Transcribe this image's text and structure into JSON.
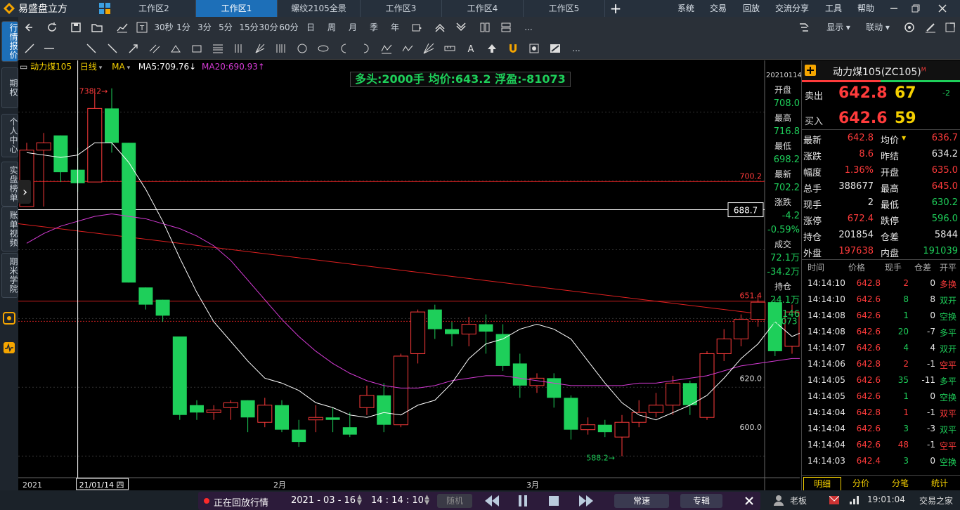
{
  "app": {
    "name": "易盛盘立方"
  },
  "tabs": [
    {
      "label": "工作区2",
      "active": false
    },
    {
      "label": "工作区1",
      "active": true
    },
    {
      "label": "螺纹2105全景",
      "active": false
    },
    {
      "label": "工作区3",
      "active": false
    },
    {
      "label": "工作区4",
      "active": false
    },
    {
      "label": "工作区5",
      "active": false
    }
  ],
  "add_tab": "+",
  "menu": [
    "系统",
    "交易",
    "回放",
    "交流分享",
    "工具",
    "帮助"
  ],
  "toolbar": {
    "periods": [
      "30秒",
      "1分",
      "3分",
      "5分",
      "15分",
      "30分",
      "60分",
      "日",
      "周",
      "月",
      "季",
      "年"
    ],
    "more": "...",
    "display_label": "显示",
    "link_label": "联动"
  },
  "draw_more": "...",
  "sidebar": [
    "行情报价",
    "期权",
    "个人中心",
    "实盘榜单",
    "账单视频",
    "期米学院"
  ],
  "chart_header": {
    "symbol": "动力煤105",
    "period": "日线",
    "indicator": "MA",
    "ma5": "MA5:709.76↓",
    "ma20": "MA20:690.93↑"
  },
  "position_banner": "多头:2000手 均价:643.2 浮盈:-81073",
  "price_labels": {
    "high_mark": "738.2",
    "low_mark": "588.2",
    "line_700": "700.2",
    "line_651": "651.4",
    "crosshair": "688.7",
    "pnl": "-81073",
    "axis_620": "620.0",
    "axis_600": "600.0"
  },
  "x_axis": {
    "left_year": "2021",
    "cursor_date": "21/01/14 四",
    "feb": "2月",
    "mar": "3月"
  },
  "info_column": {
    "date": "20210114",
    "rows": [
      {
        "label": "开盘",
        "value": "708.0"
      },
      {
        "label": "最高",
        "value": "716.8"
      },
      {
        "label": "最低",
        "value": "698.2"
      },
      {
        "label": "最新",
        "value": "702.2"
      },
      {
        "label": "涨跌",
        "value": "-4.2"
      },
      {
        "label": "",
        "value": "-0.59%"
      },
      {
        "label": "成交",
        "value": "72.1万"
      },
      {
        "label": "",
        "value": "-34.2万"
      },
      {
        "label": "持仓",
        "value": "24.1万"
      },
      {
        "label": "",
        "value": "-6146"
      }
    ]
  },
  "quote": {
    "title": "动力煤105(ZC105)",
    "title_sup": "M",
    "ask": {
      "label": "卖出",
      "price": "642.8",
      "vol": "67",
      "chg": "-2"
    },
    "bid": {
      "label": "买入",
      "price": "642.6",
      "vol": "59"
    },
    "stats": [
      {
        "l1": "最新",
        "v1": "642.8",
        "c1": "red",
        "l2": "均价",
        "v2": "636.7",
        "c2": "red"
      },
      {
        "l1": "涨跌",
        "v1": "8.6",
        "c1": "red",
        "l2": "昨结",
        "v2": "634.2",
        "c2": "white"
      },
      {
        "l1": "幅度",
        "v1": "1.36%",
        "c1": "red",
        "l2": "开盘",
        "v2": "635.0",
        "c2": "red"
      },
      {
        "l1": "总手",
        "v1": "388677",
        "c1": "white",
        "l2": "最高",
        "v2": "645.0",
        "c2": "red"
      },
      {
        "l1": "现手",
        "v1": "2",
        "c1": "white",
        "l2": "最低",
        "v2": "630.2",
        "c2": "green"
      },
      {
        "l1": "涨停",
        "v1": "672.4",
        "c1": "red",
        "l2": "跌停",
        "v2": "596.0",
        "c2": "green"
      },
      {
        "l1": "持仓",
        "v1": "201854",
        "c1": "white",
        "l2": "仓差",
        "v2": "5844",
        "c2": "white"
      },
      {
        "l1": "外盘",
        "v1": "197638",
        "c1": "red",
        "l2": "内盘",
        "v2": "191039",
        "c2": "green"
      }
    ],
    "tick_headers": [
      "时间",
      "价格",
      "现手",
      "仓差",
      "开平"
    ],
    "ticks": [
      {
        "time": "14:14:10",
        "price": "642.8",
        "vol": "2",
        "vc": "red",
        "oi": "0",
        "type": "多换",
        "tc": "red"
      },
      {
        "time": "14:14:10",
        "price": "642.6",
        "vol": "8",
        "vc": "green",
        "oi": "8",
        "type": "双开",
        "tc": "green"
      },
      {
        "time": "14:14:08",
        "price": "642.6",
        "vol": "1",
        "vc": "green",
        "oi": "0",
        "type": "空换",
        "tc": "green"
      },
      {
        "time": "14:14:08",
        "price": "642.6",
        "vol": "20",
        "vc": "green",
        "oi": "-7",
        "type": "多平",
        "tc": "green"
      },
      {
        "time": "14:14:07",
        "price": "642.6",
        "vol": "4",
        "vc": "green",
        "oi": "4",
        "type": "双开",
        "tc": "green"
      },
      {
        "time": "14:14:06",
        "price": "642.8",
        "vol": "2",
        "vc": "red",
        "oi": "-1",
        "type": "空平",
        "tc": "red"
      },
      {
        "time": "14:14:05",
        "price": "642.6",
        "vol": "35",
        "vc": "green",
        "oi": "-11",
        "type": "多平",
        "tc": "green"
      },
      {
        "time": "14:14:05",
        "price": "642.6",
        "vol": "1",
        "vc": "green",
        "oi": "0",
        "type": "空换",
        "tc": "green"
      },
      {
        "time": "14:14:04",
        "price": "642.8",
        "vol": "1",
        "vc": "red",
        "oi": "-1",
        "type": "双平",
        "tc": "red"
      },
      {
        "time": "14:14:04",
        "price": "642.6",
        "vol": "3",
        "vc": "green",
        "oi": "-3",
        "type": "双平",
        "tc": "green"
      },
      {
        "time": "14:14:04",
        "price": "642.6",
        "vol": "48",
        "vc": "red",
        "oi": "-1",
        "type": "空平",
        "tc": "red"
      },
      {
        "time": "14:14:03",
        "price": "642.4",
        "vol": "3",
        "vc": "green",
        "oi": "0",
        "type": "空换",
        "tc": "green"
      }
    ],
    "bottom_tabs": [
      "明细",
      "分价",
      "分笔",
      "统计"
    ]
  },
  "replay": {
    "status": "正在回放行情",
    "date": "2021 - 03 - 16",
    "time": "14 : 14 : 10",
    "random": "随机",
    "speed": "常速",
    "mode": "专辑"
  },
  "status": {
    "user": "老板",
    "clock": "19:01:04",
    "brand": "交易之家"
  },
  "colors": {
    "up": "#ff3b3b",
    "down": "#1ecf5a",
    "ma5": "#ffffff",
    "ma20": "#d63bd6",
    "accent": "#1d6fb8"
  },
  "chart_data": {
    "type": "candlestick",
    "ylim": [
      580,
      745
    ],
    "candles": [
      {
        "o": 690.0,
        "c": 713.0,
        "h": 716.0,
        "l": 690.0
      },
      {
        "o": 713.0,
        "c": 716.0,
        "h": 720.0,
        "l": 690.0
      },
      {
        "o": 719.0,
        "c": 704.0,
        "h": 719.0,
        "l": 700.0
      },
      {
        "o": 705.0,
        "c": 699.5,
        "h": 714.0,
        "l": 696.0
      },
      {
        "o": 700.0,
        "c": 730.0,
        "h": 738.2,
        "l": 700.0
      },
      {
        "o": 730.0,
        "c": 716.0,
        "h": 738.2,
        "l": 712.0
      },
      {
        "o": 716.0,
        "c": 659.0,
        "h": 716.0,
        "l": 659.0
      },
      {
        "o": 657.0,
        "c": 650.0,
        "h": 657.0,
        "l": 648.0
      },
      {
        "o": 652.0,
        "c": 645.5,
        "h": 652.0,
        "l": 643.0
      },
      {
        "o": 637.0,
        "c": 605.0,
        "h": 637.0,
        "l": 603.0
      },
      {
        "o": 609.0,
        "c": 606.0,
        "h": 611.0,
        "l": 603.0
      },
      {
        "o": 606.0,
        "c": 607.0,
        "h": 609.0,
        "l": 603.0
      },
      {
        "o": 608.0,
        "c": 610.0,
        "h": 611.0,
        "l": 603.0
      },
      {
        "o": 611.0,
        "c": 604.0,
        "h": 611.0,
        "l": 598.0
      },
      {
        "o": 602.0,
        "c": 609.0,
        "h": 612.0,
        "l": 600.0
      },
      {
        "o": 609.0,
        "c": 599.0,
        "h": 611.0,
        "l": 598.0
      },
      {
        "o": 599.0,
        "c": 594.0,
        "h": 603.0,
        "l": 592.0
      },
      {
        "o": 603.0,
        "c": 604.0,
        "h": 609.0,
        "l": 598.0
      },
      {
        "o": 604.0,
        "c": 603.0,
        "h": 608.0,
        "l": 598.0
      },
      {
        "o": 600.0,
        "c": 597.0,
        "h": 606.0,
        "l": 596.0
      },
      {
        "o": 608.0,
        "c": 613.0,
        "h": 617.0,
        "l": 605.0
      },
      {
        "o": 613.0,
        "c": 601.0,
        "h": 618.0,
        "l": 598.0
      },
      {
        "o": 601.0,
        "c": 629.0,
        "h": 630.0,
        "l": 600.0
      },
      {
        "o": 630.0,
        "c": 647.0,
        "h": 648.0,
        "l": 626.0
      },
      {
        "o": 648.0,
        "c": 640.0,
        "h": 650.0,
        "l": 636.0
      },
      {
        "o": 640.0,
        "c": 638.0,
        "h": 643.0,
        "l": 633.0
      },
      {
        "o": 638.0,
        "c": 642.0,
        "h": 645.0,
        "l": 633.0
      },
      {
        "o": 642.0,
        "c": 639.0,
        "h": 646.0,
        "l": 630.0
      },
      {
        "o": 638.0,
        "c": 625.0,
        "h": 642.0,
        "l": 623.0
      },
      {
        "o": 626.0,
        "c": 617.0,
        "h": 630.0,
        "l": 612.0
      },
      {
        "o": 617.0,
        "c": 620.0,
        "h": 622.0,
        "l": 614.0
      },
      {
        "o": 620.0,
        "c": 612.0,
        "h": 622.0,
        "l": 608.0
      },
      {
        "o": 612.0,
        "c": 599.0,
        "h": 613.0,
        "l": 595.0
      },
      {
        "o": 599.0,
        "c": 601.0,
        "h": 604.0,
        "l": 597.0
      },
      {
        "o": 601.0,
        "c": 598.0,
        "h": 603.0,
        "l": 596.0
      },
      {
        "o": 596.0,
        "c": 602.0,
        "h": 605.0,
        "l": 588.2
      },
      {
        "o": 602.0,
        "c": 606.0,
        "h": 611.0,
        "l": 600.0
      },
      {
        "o": 606.0,
        "c": 609.0,
        "h": 614.0,
        "l": 604.0
      },
      {
        "o": 609.0,
        "c": 618.0,
        "h": 621.0,
        "l": 605.0
      },
      {
        "o": 618.0,
        "c": 609.0,
        "h": 619.0,
        "l": 605.0
      },
      {
        "o": 604.0,
        "c": 630.0,
        "h": 631.0,
        "l": 603.0
      },
      {
        "o": 630.0,
        "c": 636.0,
        "h": 640.0,
        "l": 627.0
      },
      {
        "o": 636.0,
        "c": 644.0,
        "h": 646.0,
        "l": 633.0
      },
      {
        "o": 644.0,
        "c": 651.0,
        "h": 654.0,
        "l": 641.0
      },
      {
        "o": 651.0,
        "c": 631.0,
        "h": 652.0,
        "l": 629.0
      },
      {
        "o": 633.0,
        "c": 647.0,
        "h": 650.0,
        "l": 630.0
      },
      {
        "o": 647.0,
        "c": 646.0,
        "h": 649.0,
        "l": 641.0
      },
      {
        "o": 645.0,
        "c": 628.0,
        "h": 646.0,
        "l": 627.0
      },
      {
        "o": 629.0,
        "c": 642.0,
        "h": 646.0,
        "l": 628.0
      },
      {
        "o": 637.0,
        "c": 643.0,
        "h": 648.0,
        "l": 634.0
      },
      {
        "o": 643.0,
        "c": 630.0,
        "h": 646.0,
        "l": 621.0
      },
      {
        "o": 635.0,
        "c": 643.0,
        "h": 645.0,
        "l": 630.0
      }
    ],
    "ma5": [
      712,
      711,
      710,
      711,
      716,
      716,
      708,
      697,
      684,
      669,
      655,
      643,
      635,
      627,
      620,
      618,
      615,
      610,
      608,
      605,
      604,
      606,
      605,
      609,
      611,
      618,
      628,
      634,
      636,
      640,
      642,
      640,
      636,
      627,
      618,
      610,
      605,
      603,
      606,
      609,
      613,
      620,
      628,
      634,
      643,
      637,
      640,
      642,
      638,
      636,
      638,
      637
    ],
    "ma20": [
      675,
      679,
      682,
      684,
      686,
      687,
      686,
      685,
      683,
      681,
      678,
      674,
      668,
      660,
      652,
      644,
      637,
      631,
      626,
      622,
      619,
      617,
      616,
      616,
      617,
      619,
      620,
      621,
      621,
      620,
      619,
      618,
      617,
      617,
      617,
      617,
      618,
      618,
      619,
      620,
      621,
      623,
      625,
      626,
      627,
      628,
      628,
      628,
      629,
      630,
      631,
      632
    ],
    "hlines": [
      700.2,
      688.7,
      651.4,
      643.2
    ],
    "trendline": {
      "from": 683,
      "to": 646
    }
  }
}
